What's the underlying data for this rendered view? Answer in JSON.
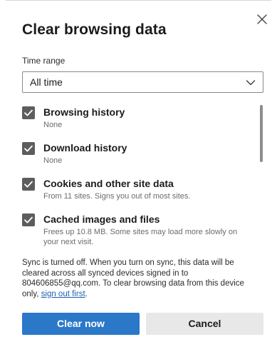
{
  "dialog": {
    "title": "Clear browsing data",
    "close_icon": "close-icon"
  },
  "time_range": {
    "label": "Time range",
    "selected": "All time",
    "chevron_icon": "chevron-down-icon"
  },
  "items": [
    {
      "title": "Browsing history",
      "description": "None",
      "checked": true
    },
    {
      "title": "Download history",
      "description": "None",
      "checked": true
    },
    {
      "title": "Cookies and other site data",
      "description": "From 11 sites. Signs you out of most sites.",
      "checked": true
    },
    {
      "title": "Cached images and files",
      "description": "Frees up 10.8 MB. Some sites may load more slowly on your next visit.",
      "checked": true
    }
  ],
  "sync_note": {
    "text": "Sync is turned off. When you turn on sync, this data will be cleared across all synced devices signed in to 804606855@qq.com. To clear browsing data from this device only, ",
    "link": "sign out first",
    "end": "."
  },
  "buttons": {
    "primary": "Clear now",
    "secondary": "Cancel"
  },
  "colors": {
    "primary_button": "#2b78c9",
    "checkbox": "#5d5d5d",
    "link": "#1f5fb2"
  }
}
